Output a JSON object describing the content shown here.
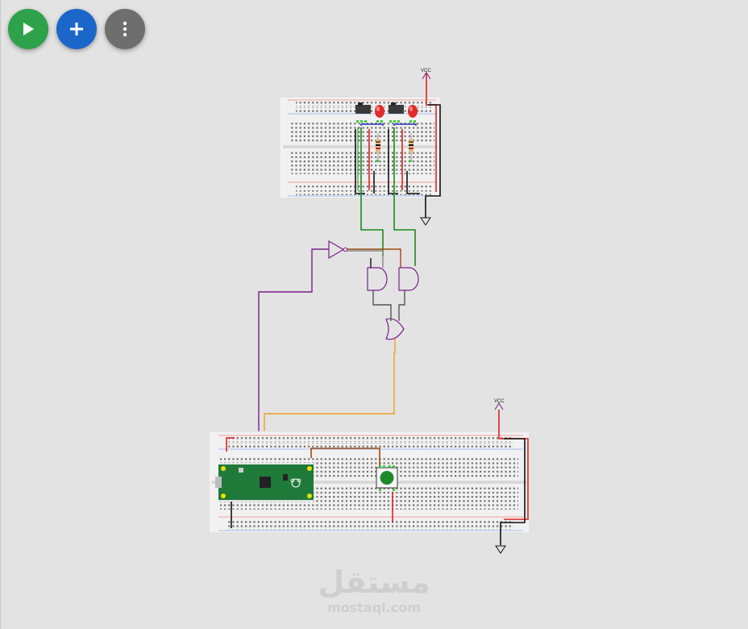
{
  "toolbar": {
    "run_icon": "play-icon",
    "add_icon": "plus-icon",
    "more_icon": "more-vertical-icon",
    "run_color": "#2ea24a",
    "add_color": "#1a67c9",
    "more_color": "#6e6e6e"
  },
  "circuit": {
    "vcc_top": "VCC",
    "vcc_bottom": "VCC",
    "board": "Raspberry Pi Pico"
  },
  "watermark": {
    "logo": "مستقل",
    "url": "mostaql.com"
  },
  "wire_colors": {
    "power": "#e02020",
    "ground": "#111111",
    "signal_green": "#1a8a1a",
    "signal_purple": "#7a1f8a",
    "signal_orange": "#f0a020",
    "signal_brown": "#9a4a10",
    "signal_blue": "#2030c0",
    "signal_gray": "#555555"
  }
}
